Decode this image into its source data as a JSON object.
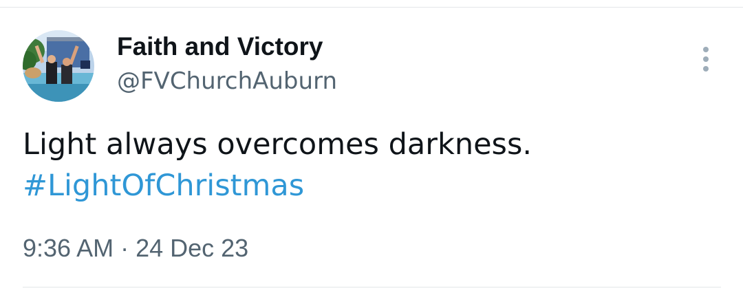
{
  "tweet": {
    "author": {
      "display_name": "Faith and Victory",
      "handle": "@FVChurchAuburn",
      "avatar_icon": "profile-photo"
    },
    "text": "Light always overcomes darkness.",
    "hashtag": "#LightOfChristmas",
    "time": "9:36 AM",
    "separator": "·",
    "date": "24 Dec 23",
    "more_icon": "more-vertical-icon"
  },
  "colors": {
    "text": "#0f1419",
    "secondary": "#536471",
    "link": "#2f97d6",
    "divider": "#e3e6e8"
  }
}
